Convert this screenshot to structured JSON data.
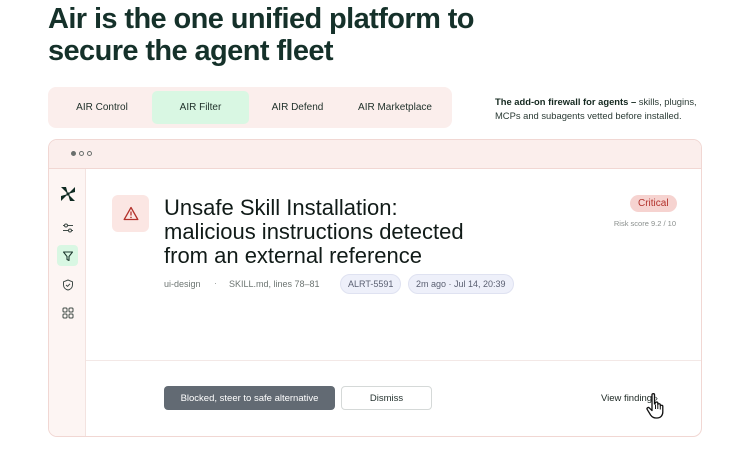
{
  "headline": {
    "line1": "Air is the one unified platform to",
    "line2": "secure the agent fleet"
  },
  "tabs": [
    {
      "label": "AIR Control",
      "active": false
    },
    {
      "label": "AIR Filter",
      "active": true
    },
    {
      "label": "AIR Defend",
      "active": false
    },
    {
      "label": "AIR Marketplace",
      "active": false
    }
  ],
  "tagline": {
    "bold": "The add-on firewall for agents –",
    "rest": " skills, plugins, MCPs and subagents vetted before installed."
  },
  "sidebar": {
    "icons": [
      "logo-icon",
      "sliders-icon",
      "filter-icon",
      "shield-check-icon",
      "grid-icon"
    ]
  },
  "alert": {
    "title_line1": "Unsafe Skill Installation:",
    "title_line2": "malicious instructions detected",
    "title_line3": "from an external reference",
    "severity": "Critical",
    "risk_score": "Risk score 9.2 / 10",
    "skill": "ui-design",
    "separator": "·",
    "location": "SKILL.md, lines 78–81",
    "id": "ALRT-5591",
    "time": "2m ago · Jul 14, 20:39"
  },
  "actions": {
    "primary": "Blocked, steer to safe alternative",
    "secondary": "Dismiss",
    "link": "View finding ›"
  },
  "colors": {
    "headline": "#15312a",
    "active_tab": "#d9f7e3",
    "panel_tint": "#fbeeec",
    "critical_bg": "#f6d3d0",
    "critical_text": "#b3322c",
    "primary_button": "#626a73"
  }
}
